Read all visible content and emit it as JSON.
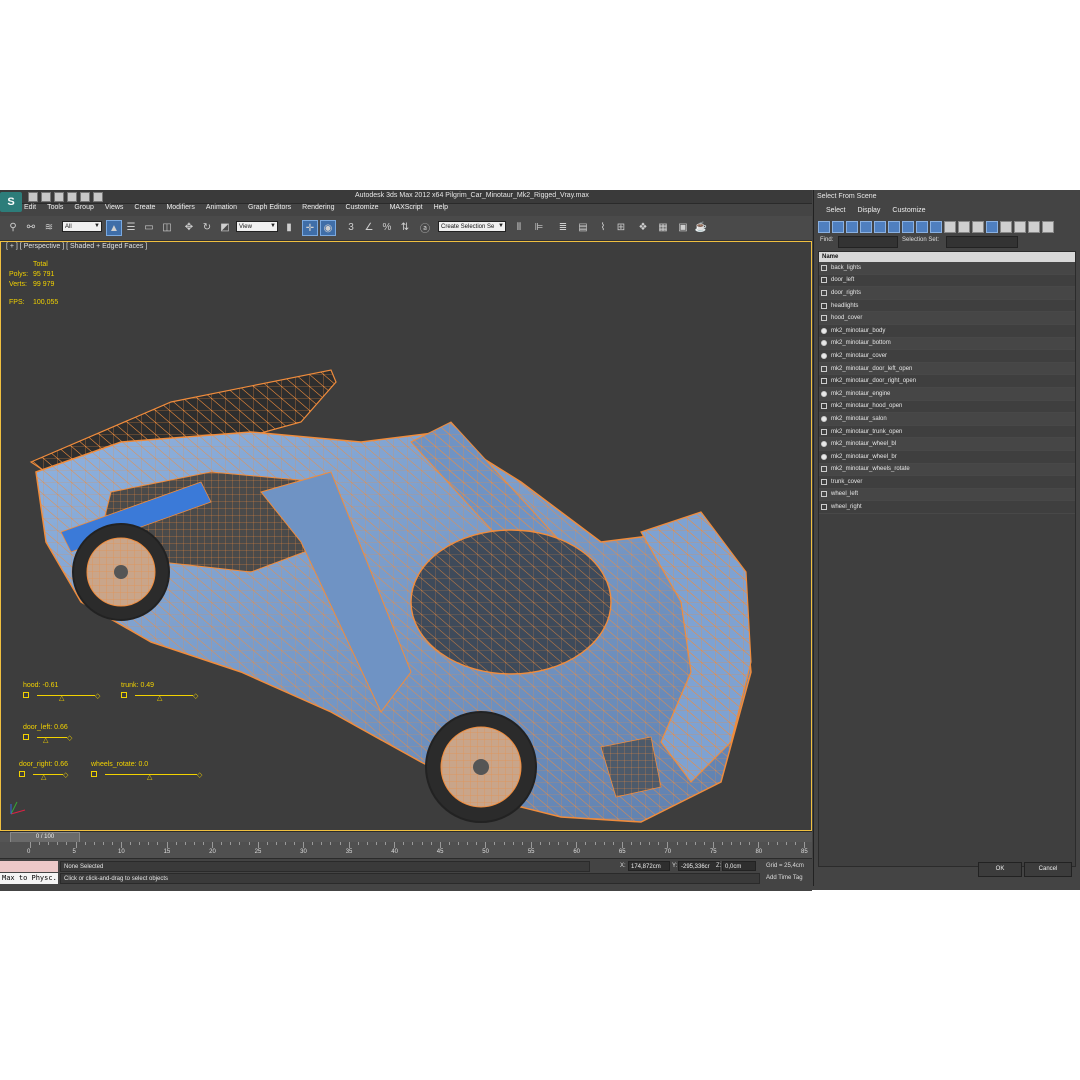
{
  "window": {
    "title": "Autodesk 3ds Max  2012 x64    Pilgrim_Car_Minotaur_Mk2_Rigged_Vray.max"
  },
  "menu": [
    "Edit",
    "Tools",
    "Group",
    "Views",
    "Create",
    "Modifiers",
    "Animation",
    "Graph Editors",
    "Rendering",
    "Customize",
    "MAXScript",
    "Help"
  ],
  "toolbar": {
    "filter_value": "All",
    "refcoord_value": "View",
    "selection_set_value": "Create Selection Se"
  },
  "viewport": {
    "label": "[ + ] [ Perspective ] [ Shaded + Edged Faces ]",
    "stats": {
      "total_label": "Total",
      "polys_label": "Polys:",
      "polys_value": "95 791",
      "verts_label": "Verts:",
      "verts_value": "99 979",
      "fps_label": "FPS:",
      "fps_value": "100,055"
    },
    "sliders": {
      "hood": "hood: -0.61",
      "trunk": "trunk: 0.49",
      "door_left": "door_left: 0.66",
      "door_right": "door_right: 0.66",
      "wheels_rotate": "wheels_rotate: 0.0"
    }
  },
  "timeline": {
    "slider_label": "0 / 100",
    "ticks": [
      "0",
      "5",
      "10",
      "15",
      "20",
      "25",
      "30",
      "35",
      "40",
      "45",
      "50",
      "55",
      "60",
      "65",
      "70",
      "75",
      "80",
      "85"
    ]
  },
  "status": {
    "max_to_physc": "Max to Physc.",
    "selection": "None Selected",
    "prompt": "Click or click-and-drag to select objects",
    "x_label": "X:",
    "x_value": "174,872cm",
    "y_label": "Y:",
    "y_value": "-295,336cr",
    "z_label": "Z:",
    "z_value": "0,0cm",
    "grid": "Grid = 25,4cm",
    "add_time_tag": "Add Time Tag"
  },
  "scene_panel": {
    "title": "Select From Scene",
    "menu": [
      "Select",
      "Display",
      "Customize"
    ],
    "find_label": "Find:",
    "selection_set_label": "Selection Set:",
    "column_name": "Name",
    "items": [
      {
        "name": "back_lights",
        "icon": "group"
      },
      {
        "name": "door_left",
        "icon": "group"
      },
      {
        "name": "door_rights",
        "icon": "group"
      },
      {
        "name": "headlights",
        "icon": "group"
      },
      {
        "name": "hood_cover",
        "icon": "group"
      },
      {
        "name": "mk2_minotaur_body",
        "icon": "sphere"
      },
      {
        "name": "mk2_minotaur_bottom",
        "icon": "sphere"
      },
      {
        "name": "mk2_minotaur_cover",
        "icon": "sphere"
      },
      {
        "name": "mk2_minotaur_door_left_open",
        "icon": "group"
      },
      {
        "name": "mk2_minotaur_door_right_open",
        "icon": "group"
      },
      {
        "name": "mk2_minotaur_engine",
        "icon": "sphere"
      },
      {
        "name": "mk2_minotaur_hood_open",
        "icon": "group"
      },
      {
        "name": "mk2_minotaur_salon",
        "icon": "sphere"
      },
      {
        "name": "mk2_minotaur_trunk_open",
        "icon": "group"
      },
      {
        "name": "mk2_minotaur_wheel_bl",
        "icon": "sphere"
      },
      {
        "name": "mk2_minotaur_wheel_br",
        "icon": "sphere"
      },
      {
        "name": "mk2_minotaur_wheels_rotate",
        "icon": "group"
      },
      {
        "name": "trunk_cover",
        "icon": "group"
      },
      {
        "name": "wheel_left",
        "icon": "group"
      },
      {
        "name": "wheel_right",
        "icon": "group"
      }
    ],
    "ok_label": "OK",
    "cancel_label": "Cancel"
  },
  "colors": {
    "viewport_bg": "#3d3d3d",
    "wire_orange": "#f08c3c",
    "car_blue": "#7fa4d4",
    "stats_yellow": "#f2d200",
    "active_frame": "#f0c040"
  }
}
